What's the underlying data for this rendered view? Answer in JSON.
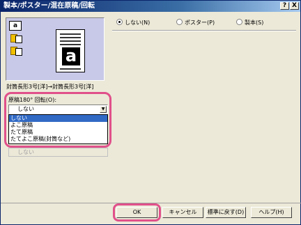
{
  "window": {
    "title": "製本/ポスター/混在原稿/回転"
  },
  "titlebar_buttons": {
    "help": "?",
    "close": "X"
  },
  "preview": {
    "big_letter": "a",
    "mini_letter": "a",
    "conversion_text": "封筒長形3号[洋]→封筒長形3号[洋]"
  },
  "rotation": {
    "label": "原稿180° 回転(O):",
    "selected": "しない",
    "options": [
      "しない",
      "よこ原稿",
      "たて原稿",
      "たてよこ原稿(封筒など)"
    ],
    "disabled_value": "しない"
  },
  "mode": {
    "options": [
      "しない(N)",
      "ポスター(P)",
      "製本(S)"
    ],
    "selected_index": 0
  },
  "buttons": {
    "ok": "OK",
    "cancel": "キャンセル",
    "default": "標準に戻す(D)",
    "help": "ヘルプ(H)"
  },
  "colors": {
    "title_bar": "#0a246a",
    "highlight": "#e0508a",
    "selection": "#316ac5",
    "preview_bg": "#c8c8e8"
  }
}
